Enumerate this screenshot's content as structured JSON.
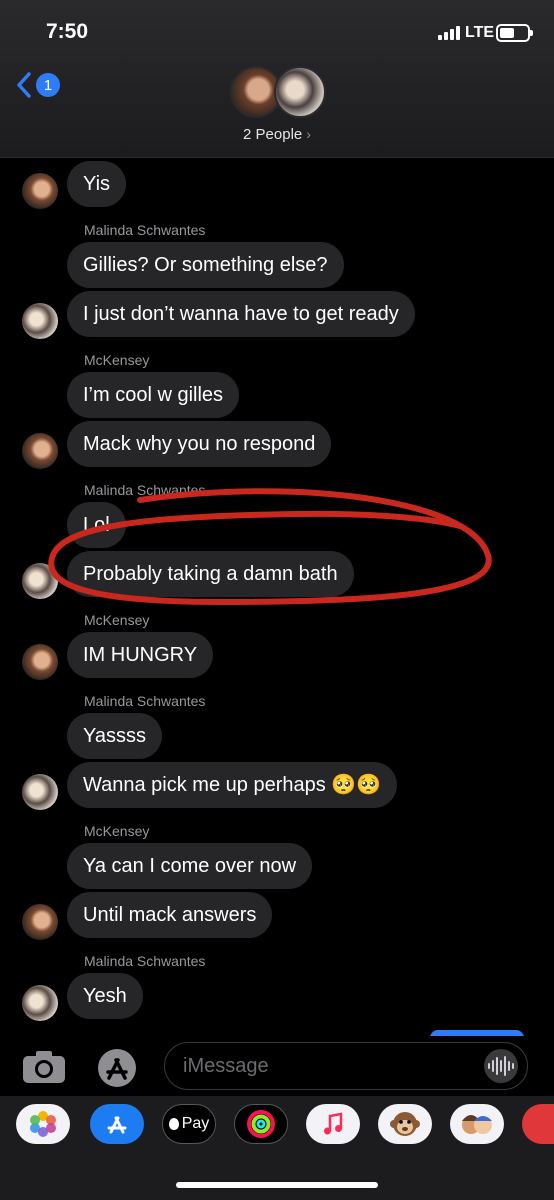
{
  "status_bar": {
    "time": "7:50",
    "network": "LTE"
  },
  "header": {
    "unread_count": "1",
    "title": "2 People",
    "title_chevron": "›"
  },
  "messages": [
    {
      "sender": "",
      "text": "Yis"
    },
    {
      "sender": "Malinda Schwantes",
      "text": "Gillies? Or something else?"
    },
    {
      "sender": "",
      "text": "I just don’t wanna have to get ready"
    },
    {
      "sender": "McKensey",
      "text": "I’m cool w gilles"
    },
    {
      "sender": "",
      "text": "Mack why you no respond"
    },
    {
      "sender": "Malinda Schwantes",
      "text": "Lol"
    },
    {
      "sender": "",
      "text": "Probably taking a damn bath"
    },
    {
      "sender": "McKensey",
      "text": "IM HUNGRY"
    },
    {
      "sender": "Malinda Schwantes",
      "text": "Yassss"
    },
    {
      "sender": "",
      "text": "Wanna pick me up perhaps 🥺🥺"
    },
    {
      "sender": "McKensey",
      "text": "Ya can I come over now"
    },
    {
      "sender": "",
      "text": "Until mack answers"
    },
    {
      "sender": "Malinda Schwantes",
      "text": "Yesh"
    }
  ],
  "input": {
    "placeholder": "iMessage"
  },
  "app_drawer": {
    "apps": [
      "photos-icon",
      "app-store-icon",
      "apple-pay-icon",
      "activity-icon",
      "music-icon",
      "monkey-memoji-icon",
      "memoji-icon",
      "more-apps-icon"
    ],
    "apple_pay_label": "Pay"
  },
  "colors": {
    "bubble": "#262628",
    "accent": "#2f7df6",
    "annotation": "#c8281e"
  }
}
